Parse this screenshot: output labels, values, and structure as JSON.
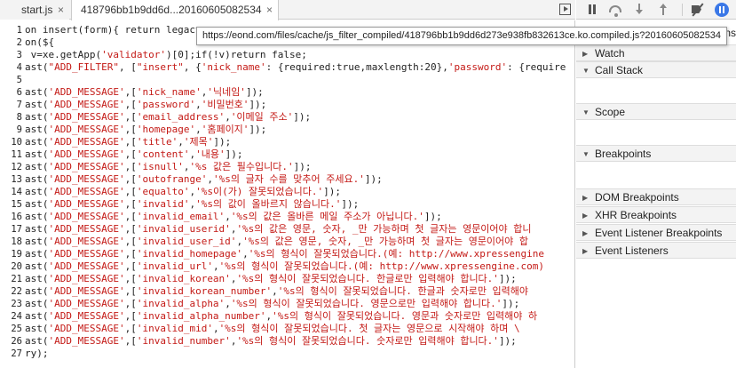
{
  "tabs": {
    "start_label": "start.js",
    "active_label": "418796bb1b9dd6d...20160605082534",
    "close_glyph": "×"
  },
  "tooltip": "https://eond.com/files/cache/js_filter_compiled/418796bb1b9dd6d273e938fb832613ce.ko.compiled.js?20160605082534",
  "editor": {
    "line_numbers": [
      "1",
      "2",
      "3",
      "4",
      "5",
      "6",
      "7",
      "8",
      "9",
      "10",
      "11",
      "12",
      "13",
      "14",
      "15",
      "16",
      "17",
      "18",
      "19",
      "20",
      "21",
      "22",
      "23",
      "24",
      "25",
      "26",
      "27"
    ],
    "lines": [
      "on insert(form){ return legacy",
      "on(${",
      " v=xe.getApp('validator')[0];if(!v)return false;",
      "ast(\"ADD_FILTER\", [\"insert\", {'nick_name': {required:true,maxlength:20},'password': {require",
      "",
      "ast('ADD_MESSAGE',['nick_name','닉네임']);",
      "ast('ADD_MESSAGE',['password','비밀번호']);",
      "ast('ADD_MESSAGE',['email_address','이메일 주소']);",
      "ast('ADD_MESSAGE',['homepage','홈페이지']);",
      "ast('ADD_MESSAGE',['title','제목']);",
      "ast('ADD_MESSAGE',['content','내용']);",
      "ast('ADD_MESSAGE',['isnull','%s 값은 필수입니다.']);",
      "ast('ADD_MESSAGE',['outofrange','%s의 글자 수를 맞추어 주세요.']);",
      "ast('ADD_MESSAGE',['equalto','%s이(가) 잘못되었습니다.']);",
      "ast('ADD_MESSAGE',['invalid','%s의 값이 올바르지 않습니다.']);",
      "ast('ADD_MESSAGE',['invalid_email','%s의 값은 올바른 메일 주소가 아닙니다.']);",
      "ast('ADD_MESSAGE',['invalid_userid','%s의 값은 영문, 숫자, _만 가능하며 첫 글자는 영문이어야 합니",
      "ast('ADD_MESSAGE',['invalid_user_id','%s의 값은 영문, 숫자, _만 가능하며 첫 글자는 영문이어야 합",
      "ast('ADD_MESSAGE',['invalid_homepage','%s의 형식이 잘못되었습니다.(예: http://www.xpressengine",
      "ast('ADD_MESSAGE',['invalid_url','%s의 형식이 잘못되었습니다.(예: http://www.xpressengine.com)",
      "ast('ADD_MESSAGE',['invalid_korean','%s의 형식이 잘못되었습니다. 한글로만 입력해야 합니다.']);",
      "ast('ADD_MESSAGE',['invalid_korean_number','%s의 형식이 잘못되었습니다. 한글과 숫자로만 입력해야",
      "ast('ADD_MESSAGE',['invalid_alpha','%s의 형식이 잘못되었습니다. 영문으로만 입력해야 합니다.']);",
      "ast('ADD_MESSAGE',['invalid_alpha_number','%s의 형식이 잘못되었습니다. 영문과 숫자로만 입력해야 하",
      "ast('ADD_MESSAGE',['invalid_mid','%s의 형식이 잘못되었습니다. 첫 글자는 영문으로 시작해야 하며 \\",
      "ast('ADD_MESSAGE',['invalid_number','%s의 형식이 잘못되었습니다. 숫자로만 입력해야 합니다.']);",
      "ry);"
    ]
  },
  "sidebar": {
    "tail_text": "ns",
    "watch": "Watch",
    "call_stack": "Call Stack",
    "scope": "Scope",
    "breakpoints": "Breakpoints",
    "dom_breakpoints": "DOM Breakpoints",
    "xhr_breakpoints": "XHR Breakpoints",
    "event_listener_breakpoints": "Event Listener Breakpoints",
    "event_listeners": "Event Listeners",
    "expand_glyph": "▶",
    "collapse_glyph": "▼"
  },
  "colors": {
    "string": "#c41a16",
    "keyword": "#aa0d91",
    "active_button": "#3b78e7"
  }
}
